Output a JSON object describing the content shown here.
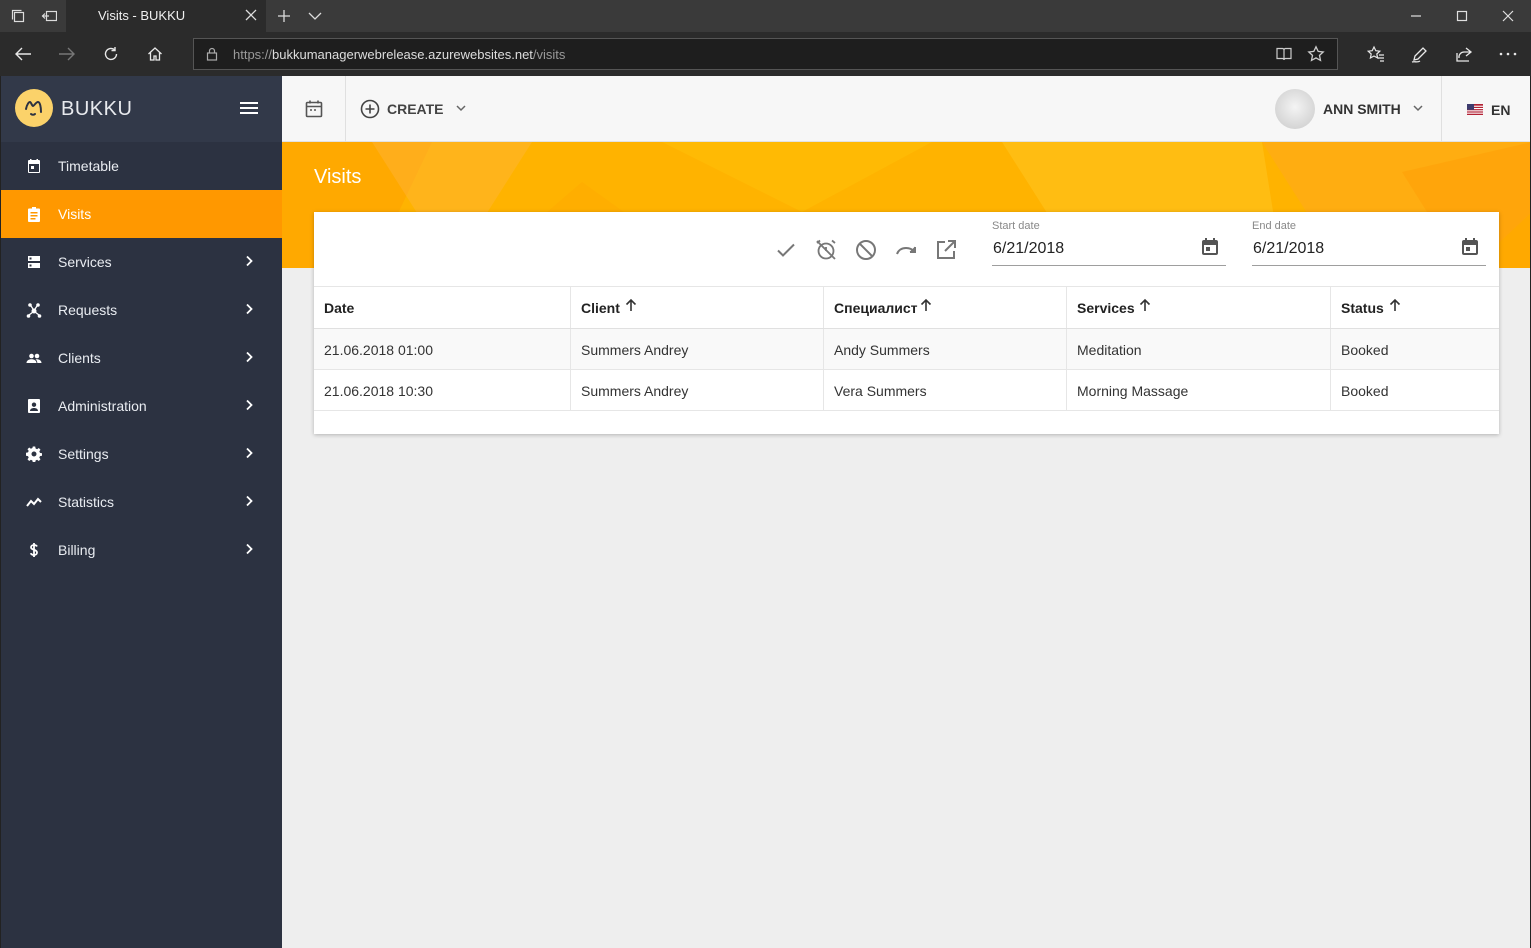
{
  "browser": {
    "tab_title": "Visits - BUKKU",
    "url_scheme": "https://",
    "url_host": "bukkumanagerwebrelease.azurewebsites.net",
    "url_path": "/visits"
  },
  "sidebar": {
    "brand": "BUKKU",
    "items": [
      {
        "label": "Timetable",
        "icon": "calendar-icon",
        "has_children": false
      },
      {
        "label": "Visits",
        "icon": "clipboard-icon",
        "has_children": false,
        "active": true
      },
      {
        "label": "Services",
        "icon": "storage-icon",
        "has_children": true
      },
      {
        "label": "Requests",
        "icon": "requests-icon",
        "has_children": true
      },
      {
        "label": "Clients",
        "icon": "people-icon",
        "has_children": true
      },
      {
        "label": "Administration",
        "icon": "badge-icon",
        "has_children": true
      },
      {
        "label": "Settings",
        "icon": "gear-icon",
        "has_children": true
      },
      {
        "label": "Statistics",
        "icon": "trending-icon",
        "has_children": true
      },
      {
        "label": "Billing",
        "icon": "dollar-icon",
        "has_children": true
      }
    ]
  },
  "topbar": {
    "create_label": "CREATE",
    "user_name": "ANN SMITH",
    "language": "EN"
  },
  "page": {
    "title": "Visits"
  },
  "filters": {
    "start_label": "Start date",
    "start_value": "6/21/2018",
    "end_label": "End date",
    "end_value": "6/21/2018"
  },
  "table": {
    "columns": [
      "Date",
      "Client",
      "Специалист",
      "Services",
      "Status"
    ],
    "rows": [
      [
        "21.06.2018 01:00",
        "Summers Andrey",
        "Andy Summers",
        "Meditation",
        "Booked"
      ],
      [
        "21.06.2018 10:30",
        "Summers Andrey",
        "Vera Summers",
        "Morning Massage",
        "Booked"
      ]
    ]
  },
  "colors": {
    "accent": "#ff9800",
    "banner": "#ffb300",
    "sidebar": "#2c3241"
  }
}
